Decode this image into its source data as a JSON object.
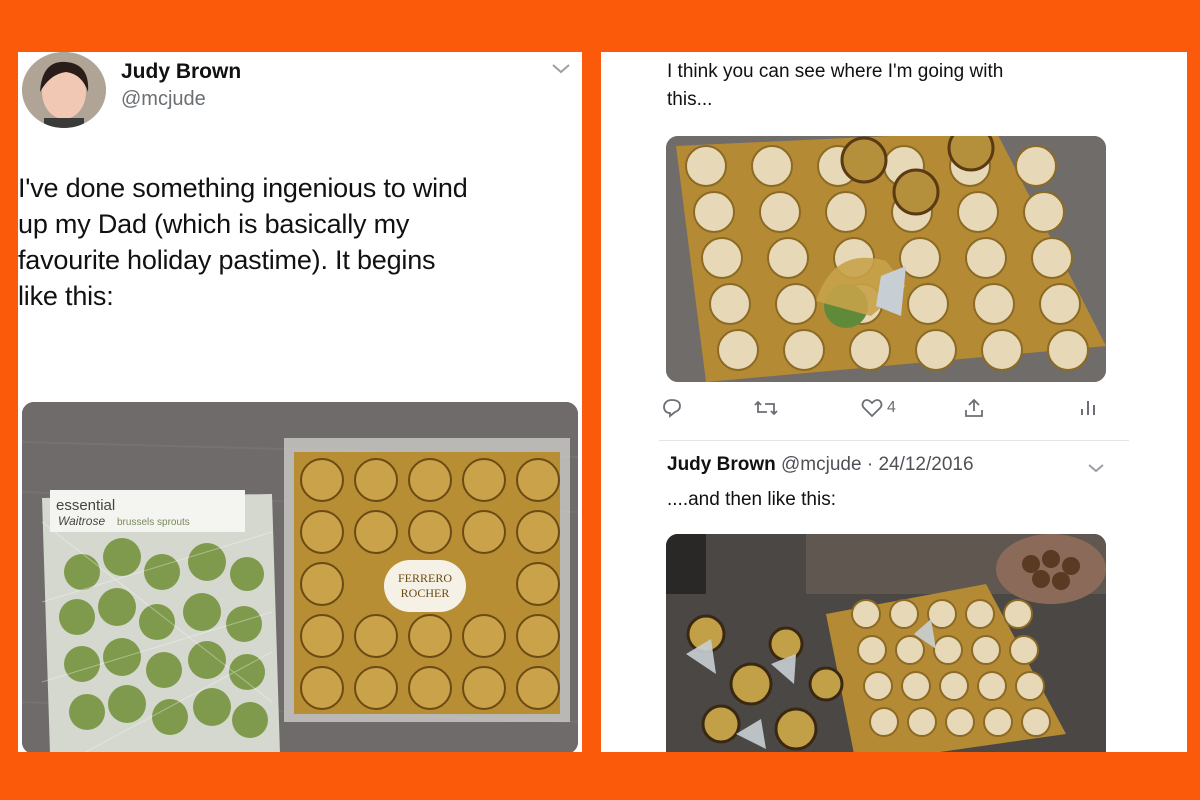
{
  "left_tweet": {
    "author_name": "Judy Brown",
    "author_handle": "@mcjude",
    "text_lines": [
      "I've done something ingenious to wind",
      "up my Dad (which is basically my",
      "favourite holiday pastime). It begins",
      "like this:"
    ],
    "photo": {
      "bag_brand_line1": "essential",
      "bag_brand_line2": "Waitrose",
      "bag_product": "brussels sprouts",
      "box_label_line1": "FERRERO",
      "box_label_line2": "ROCHER"
    }
  },
  "right_tweet": {
    "text_lines": [
      "I think you can see where I'm going with",
      "this..."
    ],
    "like_count": "4",
    "icons": [
      "reply-icon",
      "retweet-icon",
      "like-icon",
      "share-icon",
      "analytics-icon"
    ]
  },
  "reply_tweet": {
    "author_name": "Judy Brown",
    "author_handle": "@mcjude",
    "separator": " · ",
    "date": "24/12/2016",
    "text": "....and then like this:"
  },
  "colors": {
    "frame": "#fb5a0a",
    "panel": "#ffffff",
    "muted": "#6b6f73"
  }
}
